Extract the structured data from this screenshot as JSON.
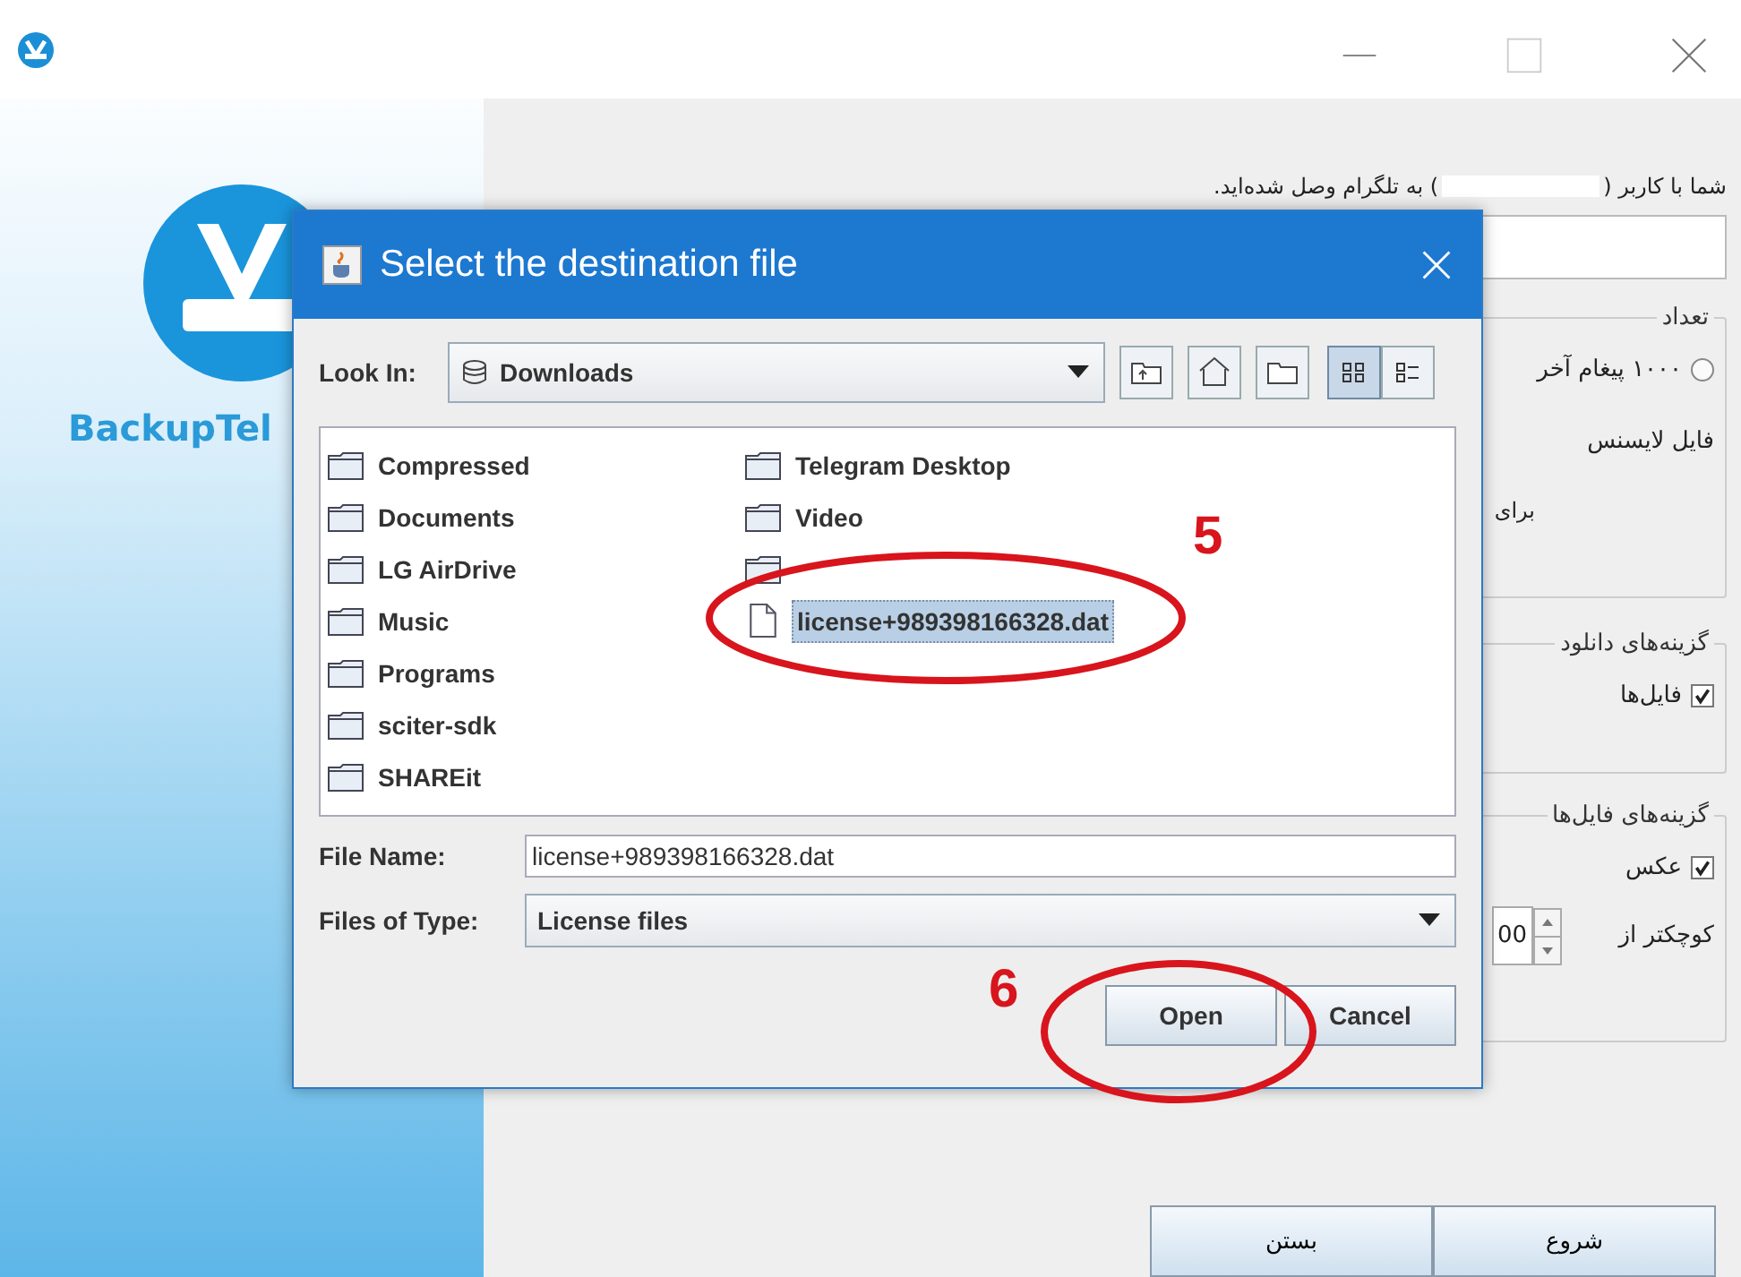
{
  "sidebar": {
    "brand": "BackupTel"
  },
  "header": {
    "before": "شما با کاربر (",
    "after": ") به تلگرام وصل شده‌اید."
  },
  "count_group": {
    "title": "تعداد",
    "radio": {
      "label": "۱۰۰۰ پیغام آخر",
      "selected": false
    },
    "license_label": "فایل لایسنس",
    "note": "برای"
  },
  "download_group": {
    "title": "گزینه‌های دانلود",
    "options": [
      {
        "label": "فایل‌ها",
        "checked": true
      }
    ]
  },
  "file_group": {
    "title": "گزینه‌های فایل‌ها",
    "options": [
      {
        "label": "عکس",
        "checked": true
      }
    ],
    "size_label": "کوچکتر از",
    "size_value": "00"
  },
  "buttons": [
    {
      "label": "شروع"
    },
    {
      "label": "بستن"
    }
  ],
  "dialog": {
    "title": "Select the destination file",
    "look_in_label": "Look In:",
    "look_in": "Downloads",
    "view_buttons": [
      {
        "kind": "list",
        "selected": true
      },
      {
        "kind": "details",
        "selected": false
      }
    ],
    "left_column": [
      {
        "name": "Compressed",
        "kind": "folder",
        "selected": false
      },
      {
        "name": "Documents",
        "kind": "folder",
        "selected": false
      },
      {
        "name": "LG AirDrive",
        "kind": "folder",
        "selected": false
      },
      {
        "name": "Music",
        "kind": "folder",
        "selected": false
      },
      {
        "name": "Programs",
        "kind": "folder",
        "selected": false
      },
      {
        "name": "sciter-sdk",
        "kind": "folder",
        "selected": false
      },
      {
        "name": "SHAREit",
        "kind": "folder",
        "selected": false
      }
    ],
    "right_column": [
      {
        "name": "Telegram Desktop",
        "kind": "folder",
        "selected": false
      },
      {
        "name": "Video",
        "kind": "folder",
        "selected": false
      },
      {
        "kind": "covered-folder"
      },
      {
        "name": "license+989398166328.dat",
        "kind": "file",
        "selected": true
      }
    ],
    "file_name_label": "File Name:",
    "file_name": "license+989398166328.dat",
    "type_label": "Files of Type:",
    "type": "License files",
    "open_button": "Open",
    "cancel_button": "Cancel"
  },
  "annotations": [
    {
      "label": "5"
    },
    {
      "label": "6"
    }
  ]
}
